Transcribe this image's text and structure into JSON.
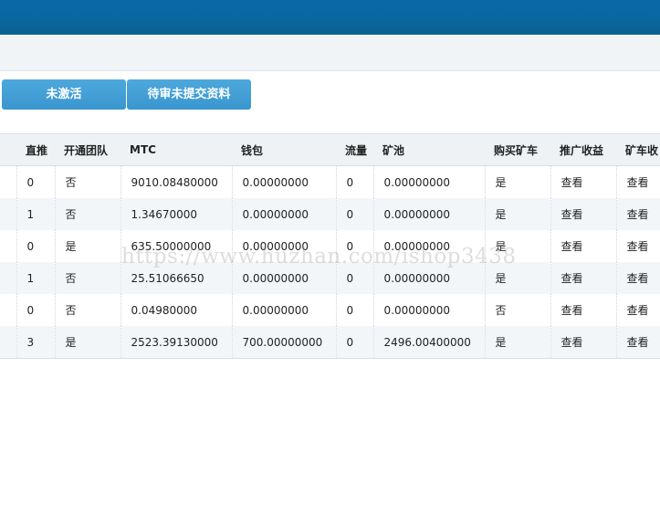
{
  "buttons": {
    "inactive": "未激活",
    "pending": "待审未提交资料"
  },
  "table": {
    "headers": [
      "",
      "直推",
      "开通团队",
      "MTC",
      "钱包",
      "流量",
      "矿池",
      "购买矿车",
      "推广收益",
      "矿车收"
    ],
    "rows": [
      {
        "zhitui": "0",
        "team": "否",
        "mtc": "9010.08480000",
        "wallet": "0.00000000",
        "flow": "0",
        "pool": "0.00000000",
        "buy": "是",
        "promo": "查看",
        "cart": "查看"
      },
      {
        "zhitui": "1",
        "team": "否",
        "mtc": "1.34670000",
        "wallet": "0.00000000",
        "flow": "0",
        "pool": "0.00000000",
        "buy": "是",
        "promo": "查看",
        "cart": "查看"
      },
      {
        "zhitui": "0",
        "team": "是",
        "mtc": "635.50000000",
        "wallet": "0.00000000",
        "flow": "0",
        "pool": "0.00000000",
        "buy": "是",
        "promo": "查看",
        "cart": "查看"
      },
      {
        "zhitui": "1",
        "team": "否",
        "mtc": "25.51066650",
        "wallet": "0.00000000",
        "flow": "0",
        "pool": "0.00000000",
        "buy": "是",
        "promo": "查看",
        "cart": "查看"
      },
      {
        "zhitui": "0",
        "team": "否",
        "mtc": "0.04980000",
        "wallet": "0.00000000",
        "flow": "0",
        "pool": "0.00000000",
        "buy": "否",
        "promo": "查看",
        "cart": "查看"
      },
      {
        "zhitui": "3",
        "team": "是",
        "mtc": "2523.39130000",
        "wallet": "700.00000000",
        "flow": "0",
        "pool": "2496.00400000",
        "buy": "是",
        "promo": "查看",
        "cart": "查看"
      }
    ]
  },
  "watermark": "https://www.huzhan.com/ishop3438"
}
